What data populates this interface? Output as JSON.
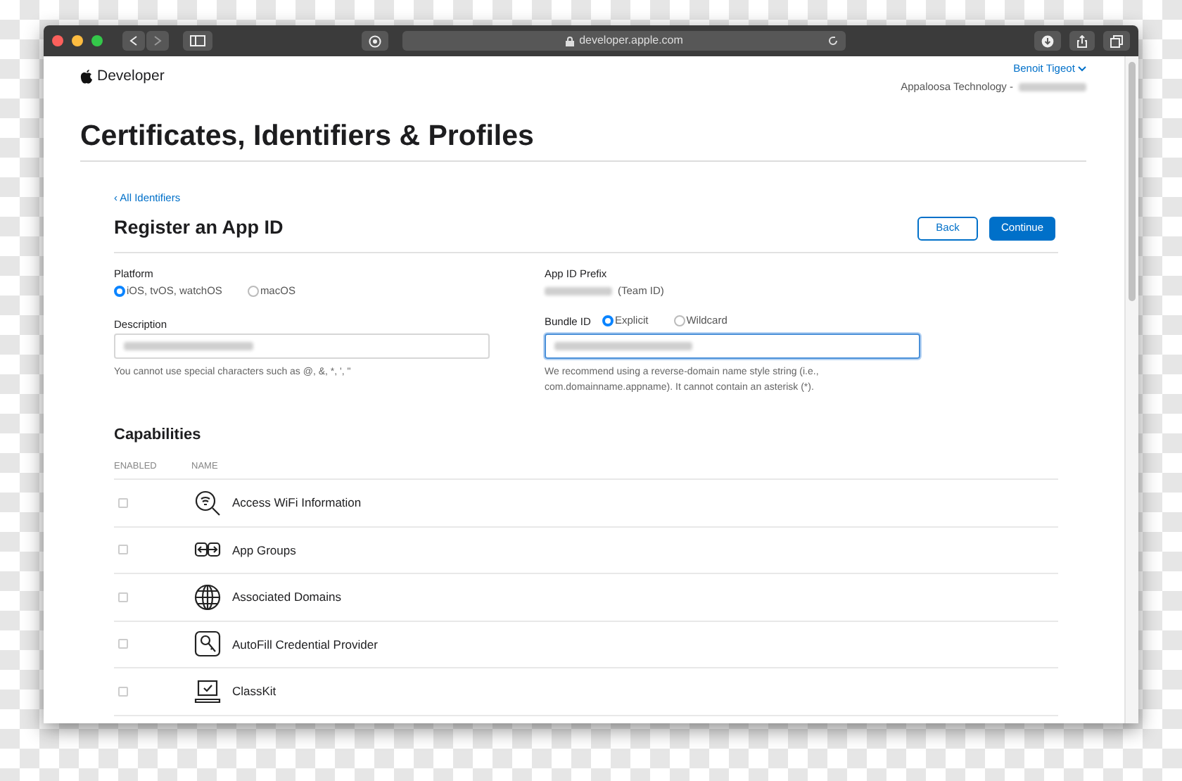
{
  "browser": {
    "url": "developer.apple.com"
  },
  "header": {
    "brand": "Developer",
    "user": "Benoit Tigeot",
    "account": "Appaloosa Technology -"
  },
  "page_title": "Certificates, Identifiers & Profiles",
  "back_link": "‹ All Identifiers",
  "form_title": "Register an App ID",
  "buttons": [
    {
      "label": "Back",
      "kind": "secondary"
    },
    {
      "label": "Continue",
      "kind": "primary"
    }
  ],
  "platform": {
    "label": "Platform",
    "options": [
      {
        "label": "iOS, tvOS, watchOS",
        "selected": true
      },
      {
        "label": "macOS",
        "selected": false
      }
    ]
  },
  "prefix": {
    "label": "App ID Prefix",
    "suffix": "(Team ID)"
  },
  "description": {
    "label": "Description",
    "focused": false,
    "hint": "You cannot use special characters such as @, &, *, ', \""
  },
  "bundle": {
    "label": "Bundle ID",
    "options": [
      {
        "label": "Explicit",
        "selected": true
      },
      {
        "label": "Wildcard",
        "selected": false
      }
    ],
    "focused": true,
    "hint": "We recommend using a reverse-domain name style string (i.e., com.domainname.appname). It cannot contain an asterisk (*)."
  },
  "capabilities": {
    "title": "Capabilities",
    "columns": [
      "ENABLED",
      "NAME"
    ],
    "rows": [
      {
        "name": "Access WiFi Information",
        "checked": false,
        "kind": "wifi"
      },
      {
        "name": "App Groups",
        "checked": false,
        "kind": "groups"
      },
      {
        "name": "Associated Domains",
        "checked": false,
        "kind": "globe"
      },
      {
        "name": "AutoFill Credential Provider",
        "checked": false,
        "kind": "key"
      },
      {
        "name": "ClassKit",
        "checked": false,
        "kind": "classkit"
      }
    ]
  }
}
